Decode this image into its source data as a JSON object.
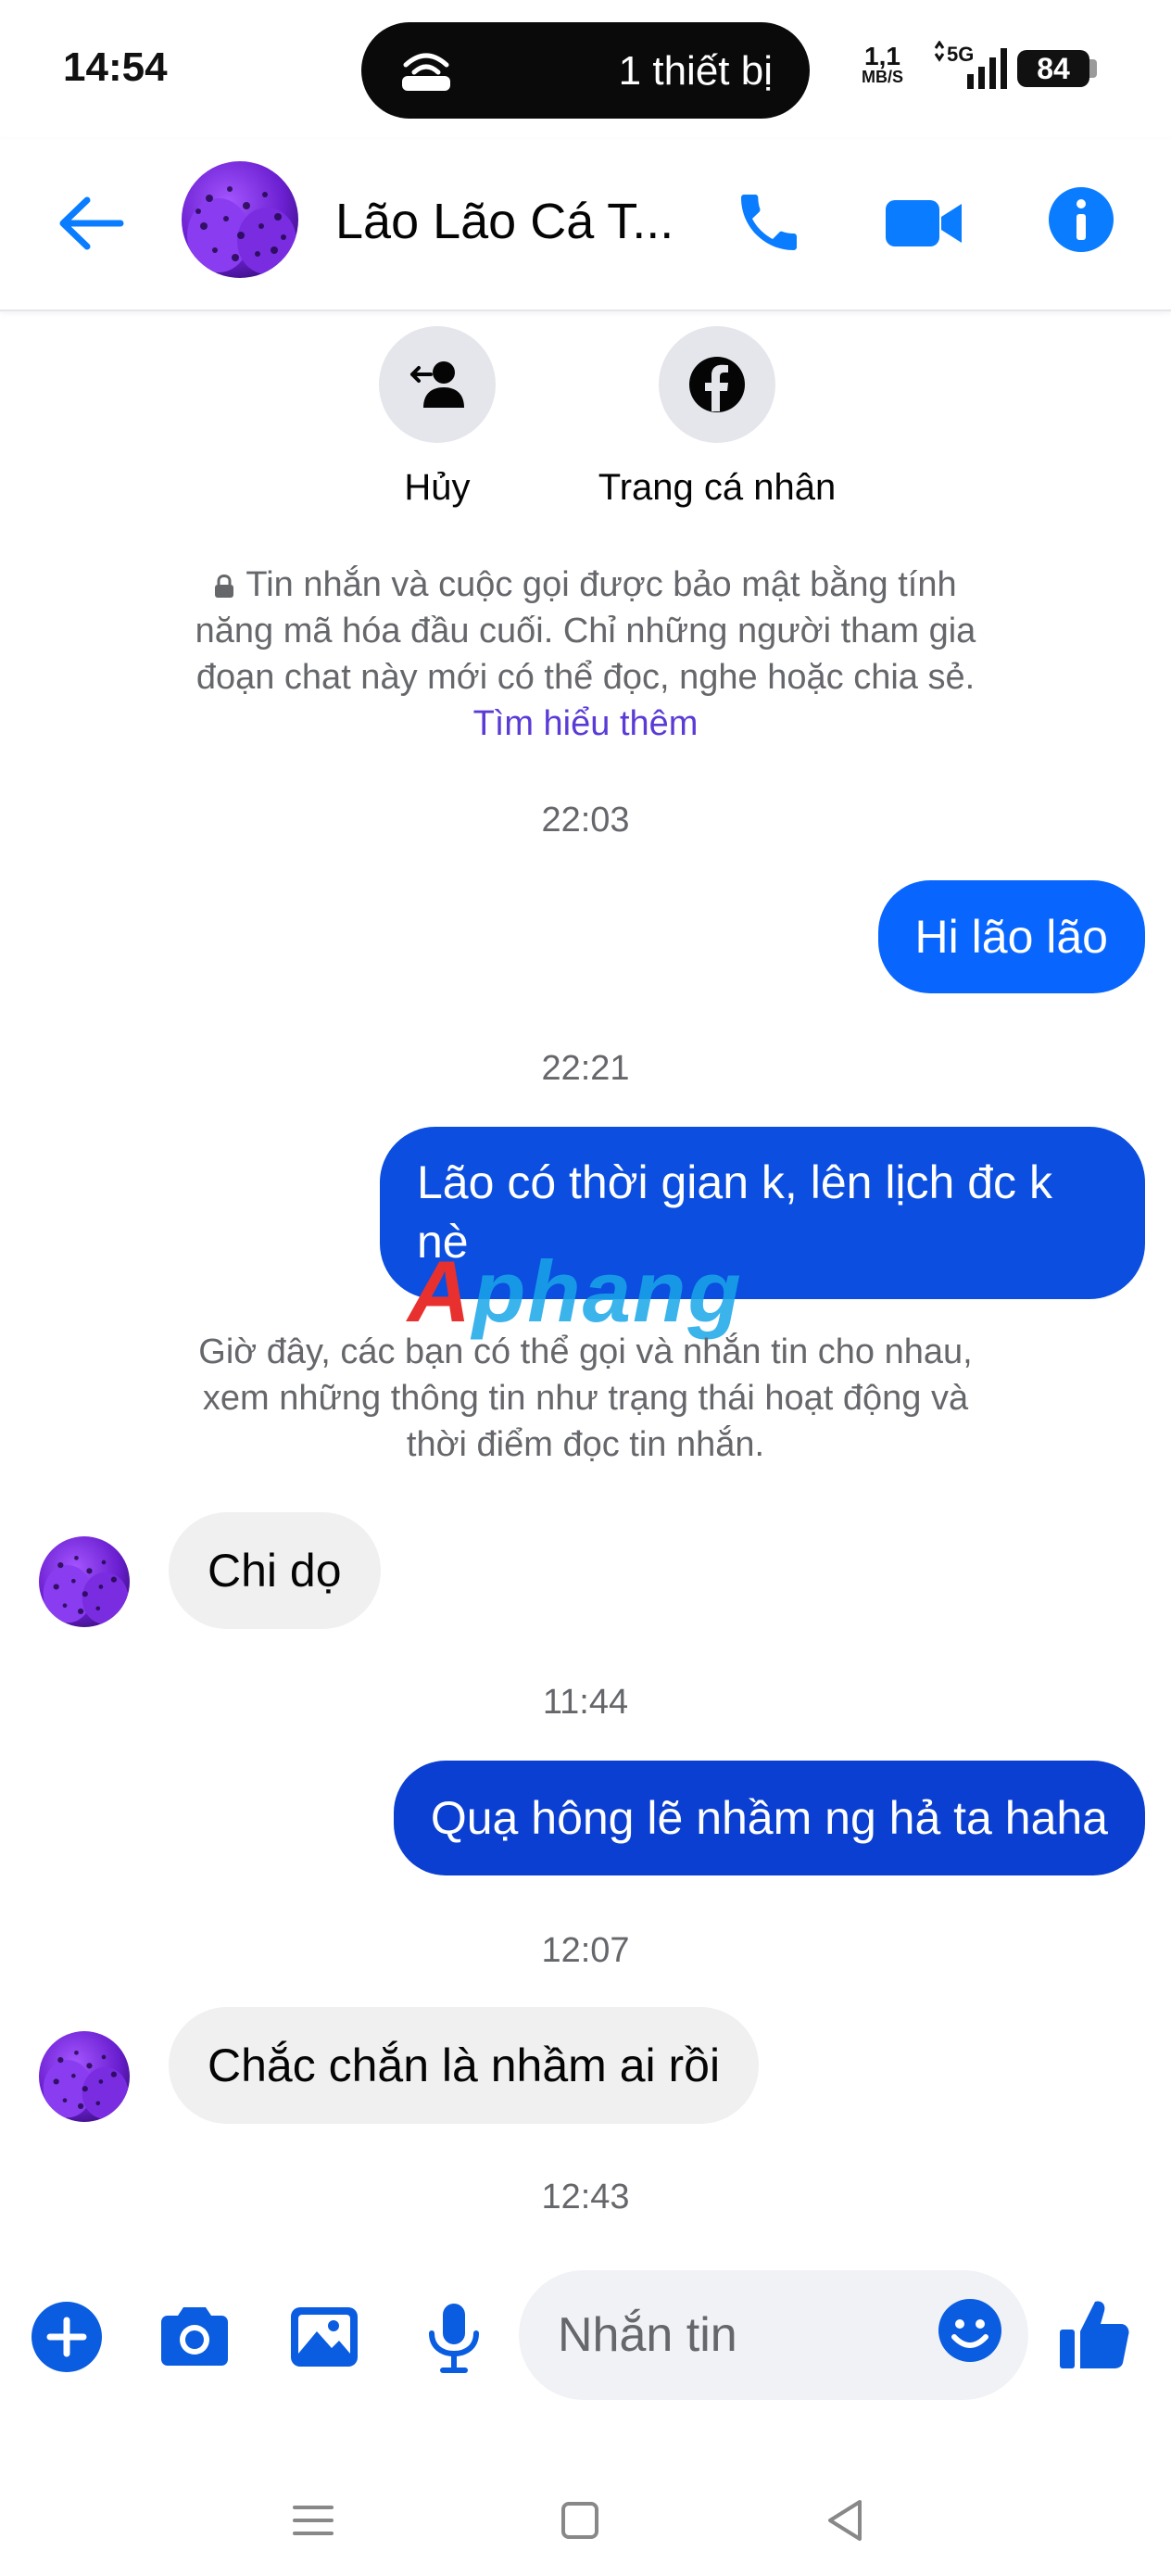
{
  "status_bar": {
    "time": "14:54",
    "island_text": "1 thiết bị",
    "net_speed_value": "1,1",
    "net_speed_unit": "MB/S",
    "network": "5G",
    "battery": "84"
  },
  "header": {
    "contact_name": "Lão Lão Cá T..."
  },
  "profile_actions": [
    {
      "label": "Hủy",
      "icon": "unfriend-icon"
    },
    {
      "label": "Trang cá nhân",
      "icon": "facebook-icon"
    }
  ],
  "e2ee_notice": {
    "text": "Tin nhắn và cuộc gọi được bảo mật bằng tính năng mã hóa đầu cuối. Chỉ những người tham gia đoạn chat này mới có thể đọc, nghe hoặc chia sẻ.",
    "link": "Tìm hiểu thêm"
  },
  "messages": {
    "ts1": "22:03",
    "m1": "Hi lão lão",
    "ts2": "22:21",
    "m2": "Lão có thời gian k, lên lịch đc k nè",
    "system_note": "Giờ đây, các bạn có thể gọi và nhắn tin cho nhau, xem những thông tin như trạng thái hoạt động và thời điểm đọc tin nhắn.",
    "m3": "Chi dọ",
    "ts3": "11:44",
    "m4": "Quạ hông lẽ nhầm ng hả ta haha",
    "ts4": "12:07",
    "m5": "Chắc chắn là nhầm ai rồi",
    "ts5": "12:43"
  },
  "watermark": {
    "first": "A",
    "rest": "phang"
  },
  "composer": {
    "placeholder": "Nhắn tin"
  },
  "colors": {
    "accent": "#0a7cff",
    "bubble_out_1": "#0866ff",
    "bubble_out_2": "#0b4ee0",
    "bubble_out_3": "#0a3fd1",
    "bubble_in": "#f0f0f0",
    "muted_text": "#65676b",
    "link": "#5a3bd6"
  }
}
